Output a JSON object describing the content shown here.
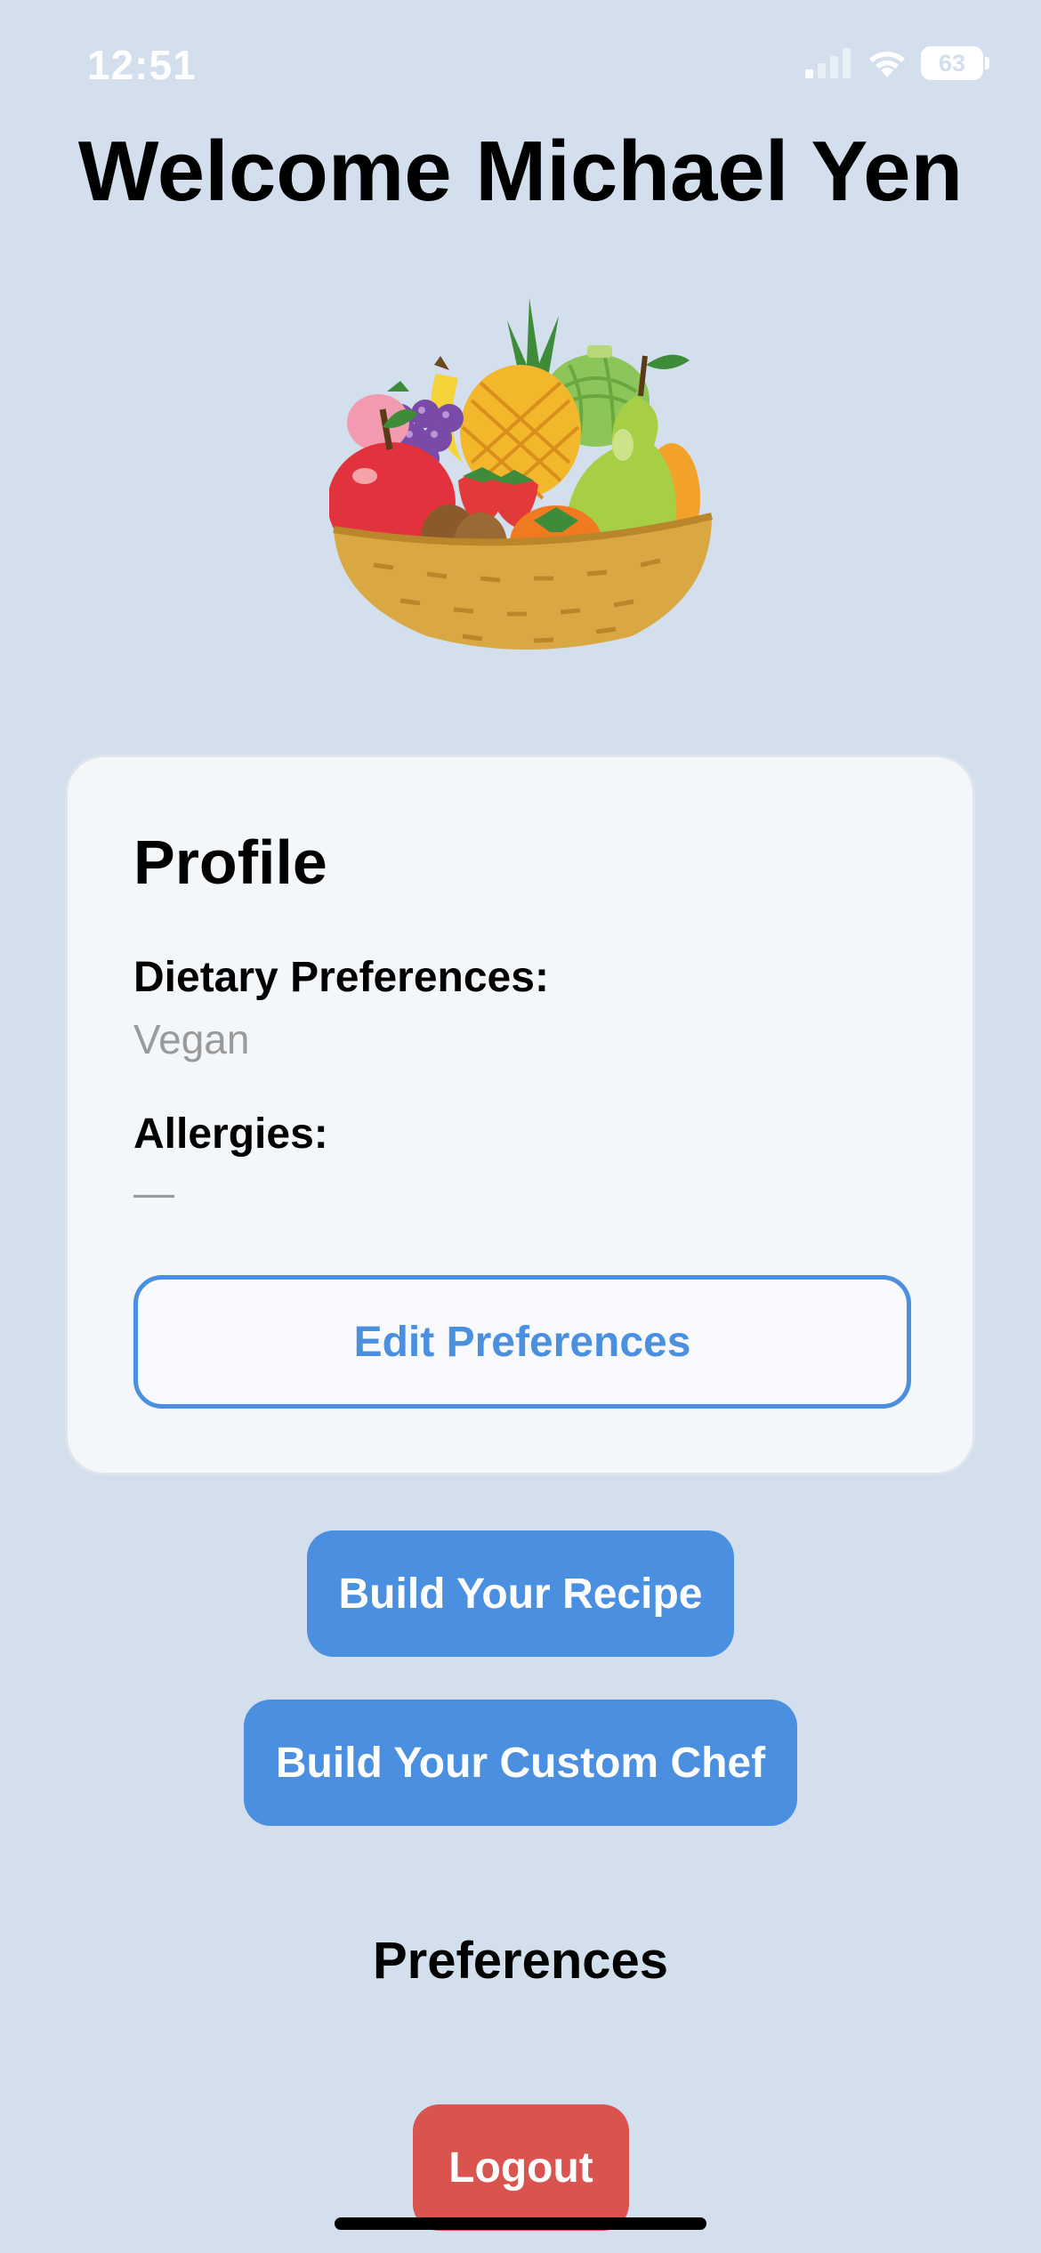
{
  "status_bar": {
    "time": "12:51",
    "battery": "63",
    "icons": [
      "signal-icon",
      "wifi-icon",
      "battery-icon"
    ]
  },
  "header": {
    "title": "Welcome Michael Yen"
  },
  "illustration": {
    "icon": "fruit-basket-illustration"
  },
  "profile": {
    "title": "Profile",
    "dietary_label": "Dietary Preferences:",
    "dietary_value": "Vegan",
    "allergies_label": "Allergies:",
    "allergies_value": "—",
    "edit_button": "Edit Preferences"
  },
  "actions": {
    "build_recipe": "Build Your Recipe",
    "build_chef": "Build Your Custom Chef"
  },
  "preferences_heading": "Preferences",
  "logout": "Logout",
  "colors": {
    "background": "#d3dfed",
    "accent": "#4a8fe0",
    "danger": "#d9534f",
    "card": "#f4f7fa"
  }
}
